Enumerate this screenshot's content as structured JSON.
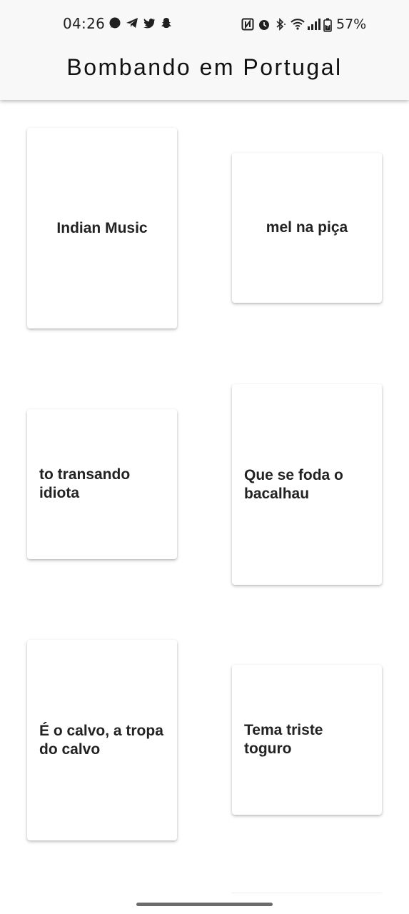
{
  "status_bar": {
    "time": "04:26",
    "notification_icons": [
      "signal-messenger-icon",
      "telegram-icon",
      "twitter-icon",
      "snapchat-icon"
    ],
    "system_icons": [
      "nfc-icon",
      "alarm-icon",
      "bluetooth-icon",
      "wifi-icon",
      "cellular-signal-icon",
      "battery-charging-icon"
    ],
    "battery_percent": "57%"
  },
  "header": {
    "title": "Bombando em Portugal"
  },
  "cards": [
    {
      "label": "Indian Music"
    },
    {
      "label": "mel na piça"
    },
    {
      "label": "to transando idiota"
    },
    {
      "label": "Que se foda o bacalhau"
    },
    {
      "label": "É o calvo, a tropa do calvo"
    },
    {
      "label": "Tema triste toguro"
    }
  ],
  "colors": {
    "app_bar_bg": "#f8f8f8",
    "card_bg": "#ffffff",
    "text": "#222222"
  }
}
